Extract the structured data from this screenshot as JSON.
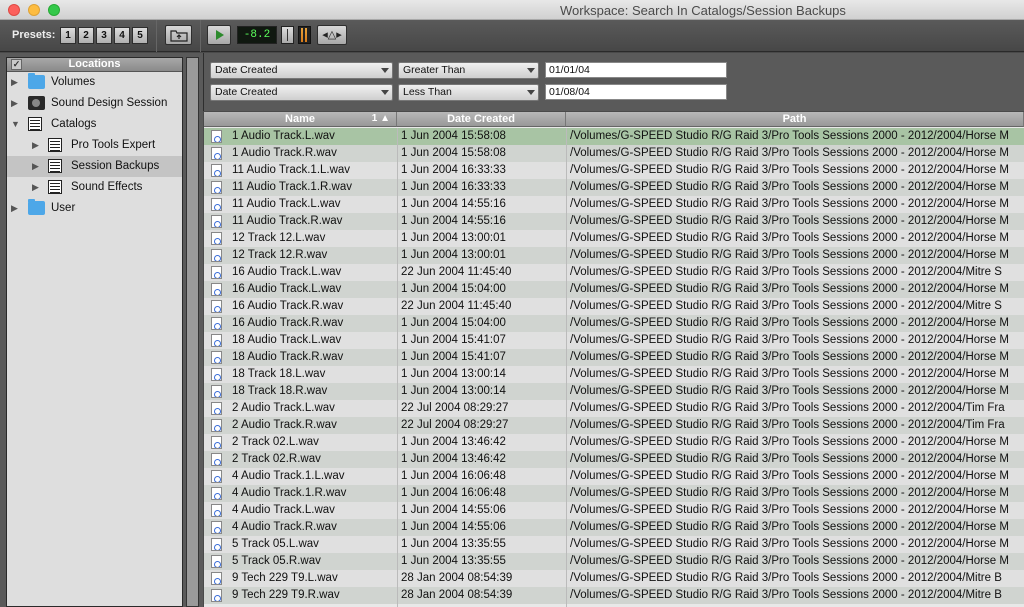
{
  "window": {
    "title": "Workspace: Search In Catalogs/Session Backups"
  },
  "toolbar": {
    "presets_label": "Presets:",
    "presets": [
      "1",
      "2",
      "3",
      "4",
      "5"
    ],
    "level": "-8.2"
  },
  "sidebar": {
    "header": "Locations",
    "items": [
      {
        "label": "Volumes",
        "icon": "folder-icon"
      },
      {
        "label": "Sound Design Session",
        "icon": "drive-icon"
      },
      {
        "label": "Catalogs",
        "icon": "catalog-icon"
      },
      {
        "label": "Pro Tools Expert",
        "icon": "catalog-icon"
      },
      {
        "label": "Session Backups",
        "icon": "catalog-icon"
      },
      {
        "label": "Sound Effects",
        "icon": "catalog-icon"
      },
      {
        "label": "User",
        "icon": "folder-icon"
      }
    ]
  },
  "criteria": [
    {
      "field": "Date Created",
      "operator": "Greater Than",
      "value": "01/01/04"
    },
    {
      "field": "Date Created",
      "operator": "Less Than",
      "value": "01/08/04"
    }
  ],
  "table": {
    "columns": {
      "name": "Name",
      "sort": "1",
      "date": "Date Created",
      "path": "Path"
    },
    "rows": [
      {
        "name": "1 Audio Track.L.wav",
        "date": "1 Jun 2004 15:58:08",
        "path": "/Volumes/G-SPEED Studio R/G Raid 3/Pro Tools Sessions 2000 - 2012/2004/Horse M"
      },
      {
        "name": "1 Audio Track.R.wav",
        "date": "1 Jun 2004 15:58:08",
        "path": "/Volumes/G-SPEED Studio R/G Raid 3/Pro Tools Sessions 2000 - 2012/2004/Horse M"
      },
      {
        "name": "11 Audio Track.1.L.wav",
        "date": "1 Jun 2004 16:33:33",
        "path": "/Volumes/G-SPEED Studio R/G Raid 3/Pro Tools Sessions 2000 - 2012/2004/Horse M"
      },
      {
        "name": "11 Audio Track.1.R.wav",
        "date": "1 Jun 2004 16:33:33",
        "path": "/Volumes/G-SPEED Studio R/G Raid 3/Pro Tools Sessions 2000 - 2012/2004/Horse M"
      },
      {
        "name": "11 Audio Track.L.wav",
        "date": "1 Jun 2004 14:55:16",
        "path": "/Volumes/G-SPEED Studio R/G Raid 3/Pro Tools Sessions 2000 - 2012/2004/Horse M"
      },
      {
        "name": "11 Audio Track.R.wav",
        "date": "1 Jun 2004 14:55:16",
        "path": "/Volumes/G-SPEED Studio R/G Raid 3/Pro Tools Sessions 2000 - 2012/2004/Horse M"
      },
      {
        "name": "12 Track 12.L.wav",
        "date": "1 Jun 2004 13:00:01",
        "path": "/Volumes/G-SPEED Studio R/G Raid 3/Pro Tools Sessions 2000 - 2012/2004/Horse M"
      },
      {
        "name": "12 Track 12.R.wav",
        "date": "1 Jun 2004 13:00:01",
        "path": "/Volumes/G-SPEED Studio R/G Raid 3/Pro Tools Sessions 2000 - 2012/2004/Horse M"
      },
      {
        "name": "16 Audio Track.L.wav",
        "date": "22 Jun 2004 11:45:40",
        "path": "/Volumes/G-SPEED Studio R/G Raid 3/Pro Tools Sessions 2000 - 2012/2004/Mitre S"
      },
      {
        "name": "16 Audio Track.L.wav",
        "date": "1 Jun 2004 15:04:00",
        "path": "/Volumes/G-SPEED Studio R/G Raid 3/Pro Tools Sessions 2000 - 2012/2004/Horse M"
      },
      {
        "name": "16 Audio Track.R.wav",
        "date": "22 Jun 2004 11:45:40",
        "path": "/Volumes/G-SPEED Studio R/G Raid 3/Pro Tools Sessions 2000 - 2012/2004/Mitre S"
      },
      {
        "name": "16 Audio Track.R.wav",
        "date": "1 Jun 2004 15:04:00",
        "path": "/Volumes/G-SPEED Studio R/G Raid 3/Pro Tools Sessions 2000 - 2012/2004/Horse M"
      },
      {
        "name": "18 Audio Track.L.wav",
        "date": "1 Jun 2004 15:41:07",
        "path": "/Volumes/G-SPEED Studio R/G Raid 3/Pro Tools Sessions 2000 - 2012/2004/Horse M"
      },
      {
        "name": "18 Audio Track.R.wav",
        "date": "1 Jun 2004 15:41:07",
        "path": "/Volumes/G-SPEED Studio R/G Raid 3/Pro Tools Sessions 2000 - 2012/2004/Horse M"
      },
      {
        "name": "18 Track 18.L.wav",
        "date": "1 Jun 2004 13:00:14",
        "path": "/Volumes/G-SPEED Studio R/G Raid 3/Pro Tools Sessions 2000 - 2012/2004/Horse M"
      },
      {
        "name": "18 Track 18.R.wav",
        "date": "1 Jun 2004 13:00:14",
        "path": "/Volumes/G-SPEED Studio R/G Raid 3/Pro Tools Sessions 2000 - 2012/2004/Horse M"
      },
      {
        "name": "2 Audio Track.L.wav",
        "date": "22 Jul 2004 08:29:27",
        "path": "/Volumes/G-SPEED Studio R/G Raid 3/Pro Tools Sessions 2000 - 2012/2004/Tim Fra"
      },
      {
        "name": "2 Audio Track.R.wav",
        "date": "22 Jul 2004 08:29:27",
        "path": "/Volumes/G-SPEED Studio R/G Raid 3/Pro Tools Sessions 2000 - 2012/2004/Tim Fra"
      },
      {
        "name": "2 Track 02.L.wav",
        "date": "1 Jun 2004 13:46:42",
        "path": "/Volumes/G-SPEED Studio R/G Raid 3/Pro Tools Sessions 2000 - 2012/2004/Horse M"
      },
      {
        "name": "2 Track 02.R.wav",
        "date": "1 Jun 2004 13:46:42",
        "path": "/Volumes/G-SPEED Studio R/G Raid 3/Pro Tools Sessions 2000 - 2012/2004/Horse M"
      },
      {
        "name": "4 Audio Track.1.L.wav",
        "date": "1 Jun 2004 16:06:48",
        "path": "/Volumes/G-SPEED Studio R/G Raid 3/Pro Tools Sessions 2000 - 2012/2004/Horse M"
      },
      {
        "name": "4 Audio Track.1.R.wav",
        "date": "1 Jun 2004 16:06:48",
        "path": "/Volumes/G-SPEED Studio R/G Raid 3/Pro Tools Sessions 2000 - 2012/2004/Horse M"
      },
      {
        "name": "4 Audio Track.L.wav",
        "date": "1 Jun 2004 14:55:06",
        "path": "/Volumes/G-SPEED Studio R/G Raid 3/Pro Tools Sessions 2000 - 2012/2004/Horse M"
      },
      {
        "name": "4 Audio Track.R.wav",
        "date": "1 Jun 2004 14:55:06",
        "path": "/Volumes/G-SPEED Studio R/G Raid 3/Pro Tools Sessions 2000 - 2012/2004/Horse M"
      },
      {
        "name": "5 Track 05.L.wav",
        "date": "1 Jun 2004 13:35:55",
        "path": "/Volumes/G-SPEED Studio R/G Raid 3/Pro Tools Sessions 2000 - 2012/2004/Horse M"
      },
      {
        "name": "5 Track 05.R.wav",
        "date": "1 Jun 2004 13:35:55",
        "path": "/Volumes/G-SPEED Studio R/G Raid 3/Pro Tools Sessions 2000 - 2012/2004/Horse M"
      },
      {
        "name": "9 Tech 229 T9.L.wav",
        "date": "28 Jan 2004 08:54:39",
        "path": "/Volumes/G-SPEED Studio R/G Raid 3/Pro Tools Sessions 2000 - 2012/2004/Mitre B"
      },
      {
        "name": "9 Tech 229 T9.R.wav",
        "date": "28 Jan 2004 08:54:39",
        "path": "/Volumes/G-SPEED Studio R/G Raid 3/Pro Tools Sessions 2000 - 2012/2004/Mitre B"
      }
    ]
  },
  "colors": {
    "selected_row": "#a8c4a4",
    "level_text": "#5cff5c",
    "folder": "#4da7e8"
  }
}
